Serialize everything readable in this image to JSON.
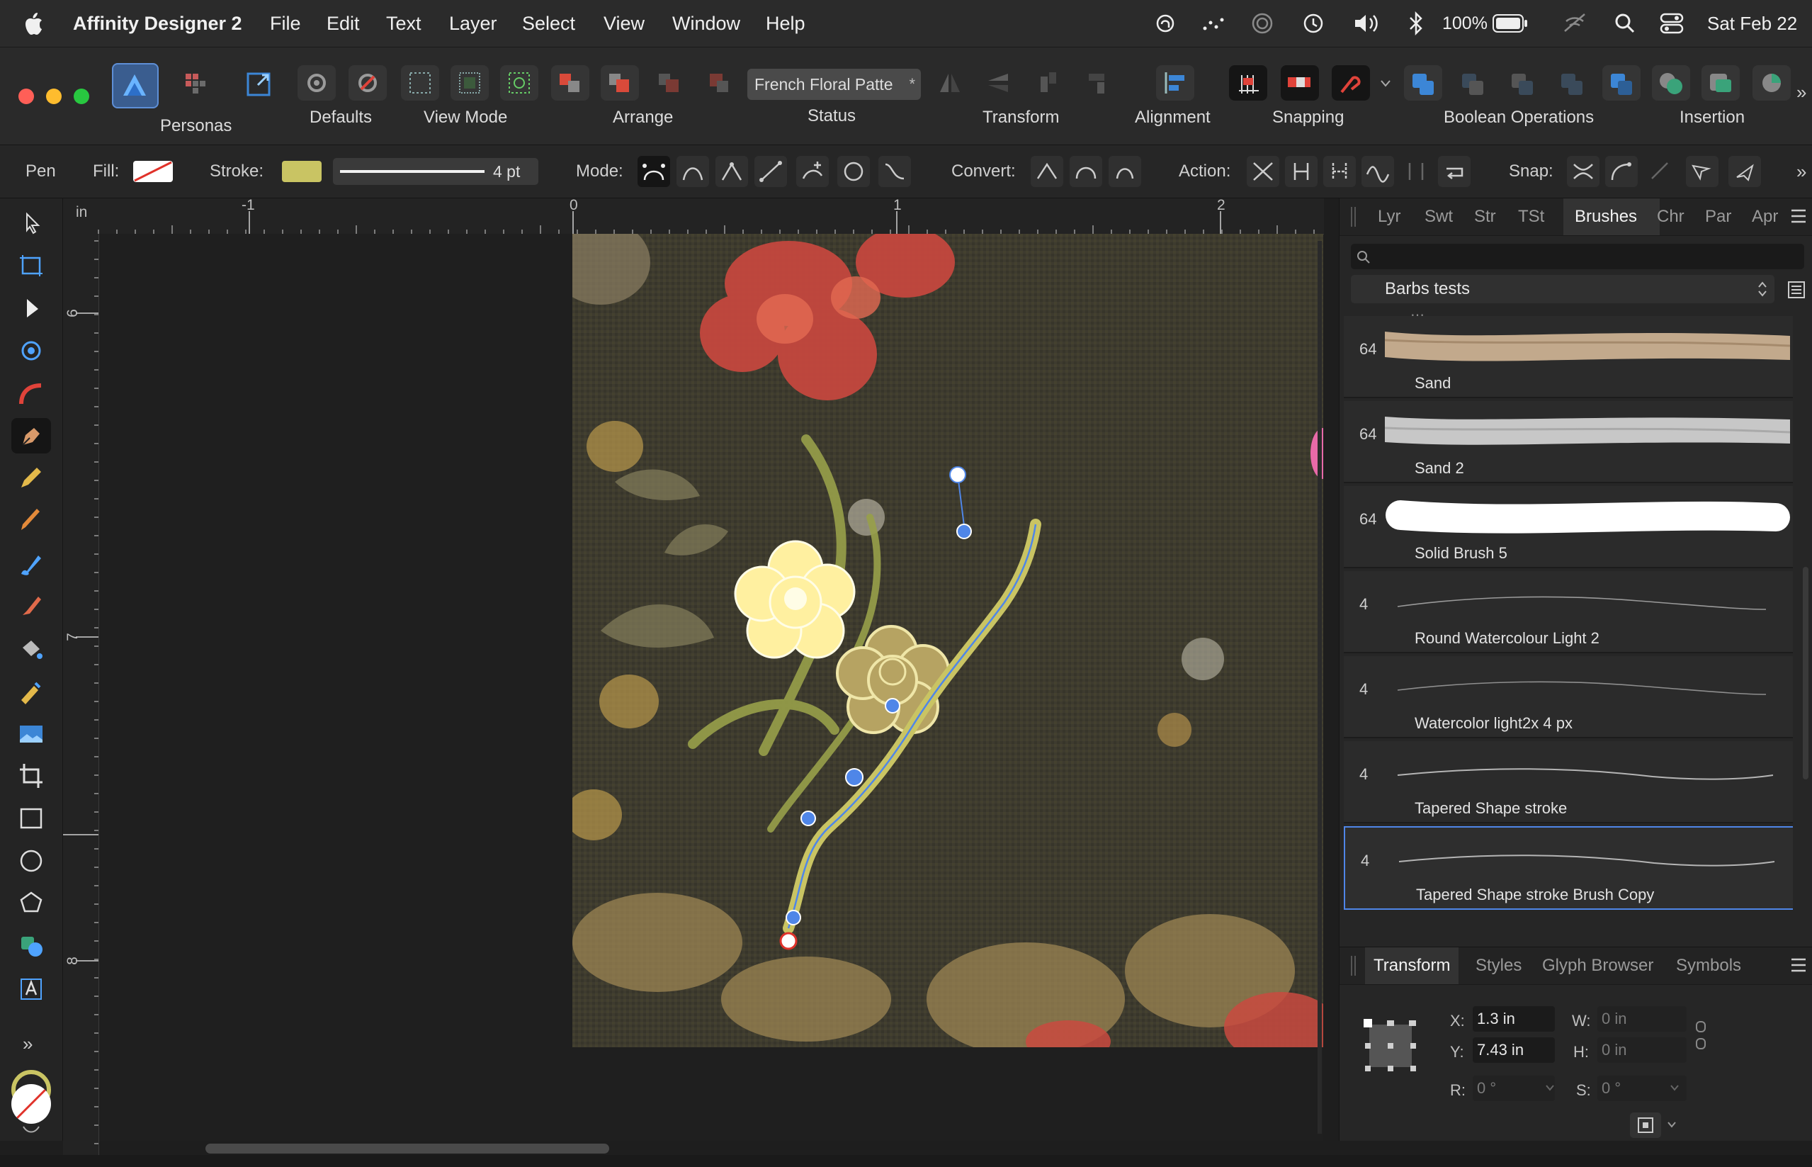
{
  "menubar": {
    "app_name": "Affinity Designer 2",
    "menus": [
      "File",
      "Edit",
      "Text",
      "Layer",
      "Select",
      "View",
      "Window",
      "Help"
    ],
    "battery": "100%",
    "date": "Sat Feb 22"
  },
  "toolbar": {
    "personas_label": "Personas",
    "defaults_label": "Defaults",
    "view_mode_label": "View Mode",
    "arrange_label": "Arrange",
    "status_label": "Status",
    "document_name": "French Floral Patte",
    "transform_label": "Transform",
    "alignment_label": "Alignment",
    "snapping_label": "Snapping",
    "boolean_label": "Boolean Operations",
    "insertion_label": "Insertion"
  },
  "context": {
    "tool_name": "Pen",
    "fill_label": "Fill:",
    "stroke_label": "Stroke:",
    "stroke_width": "4 pt",
    "mode_label": "Mode:",
    "convert_label": "Convert:",
    "action_label": "Action:",
    "snap_label": "Snap:",
    "stroke_color": "#c9c463"
  },
  "rulers": {
    "unit": "in",
    "top_ticks": [
      "-1",
      "0",
      "1",
      "2"
    ],
    "left_ticks": [
      "6",
      "7",
      "8"
    ]
  },
  "brushes_panel": {
    "tabs": [
      "Lyr",
      "Swt",
      "Str",
      "TSt",
      "Brushes",
      "Chr",
      "Par",
      "Apr"
    ],
    "active_tab": "Brushes",
    "category": "Barbs tests",
    "brushes": [
      {
        "size": "64",
        "name": "Sand"
      },
      {
        "size": "64",
        "name": "Sand 2"
      },
      {
        "size": "64",
        "name": "Solid Brush 5"
      },
      {
        "size": "4",
        "name": "Round Watercolour Light 2"
      },
      {
        "size": "4",
        "name": "Watercolor light2x 4 px"
      },
      {
        "size": "4",
        "name": "Tapered Shape stroke"
      },
      {
        "size": "4",
        "name": "Tapered Shape stroke Brush Copy"
      }
    ]
  },
  "transform_panel": {
    "tabs": [
      "Transform",
      "Styles",
      "Glyph Browser",
      "Symbols"
    ],
    "x_label": "X:",
    "x_value": "1.3 in",
    "y_label": "Y:",
    "y_value": "7.43 in",
    "w_label": "W:",
    "w_value": "0 in",
    "h_label": "H:",
    "h_value": "0 in",
    "r_label": "R:",
    "r_value": "0 °",
    "s_label": "S:",
    "s_value": "0 °"
  },
  "colors": {
    "accent": "#3d7bd9",
    "selection_blue": "#4f86e8",
    "flower_yellow": "#fff0a0",
    "flower_olive": "#b6a362"
  }
}
